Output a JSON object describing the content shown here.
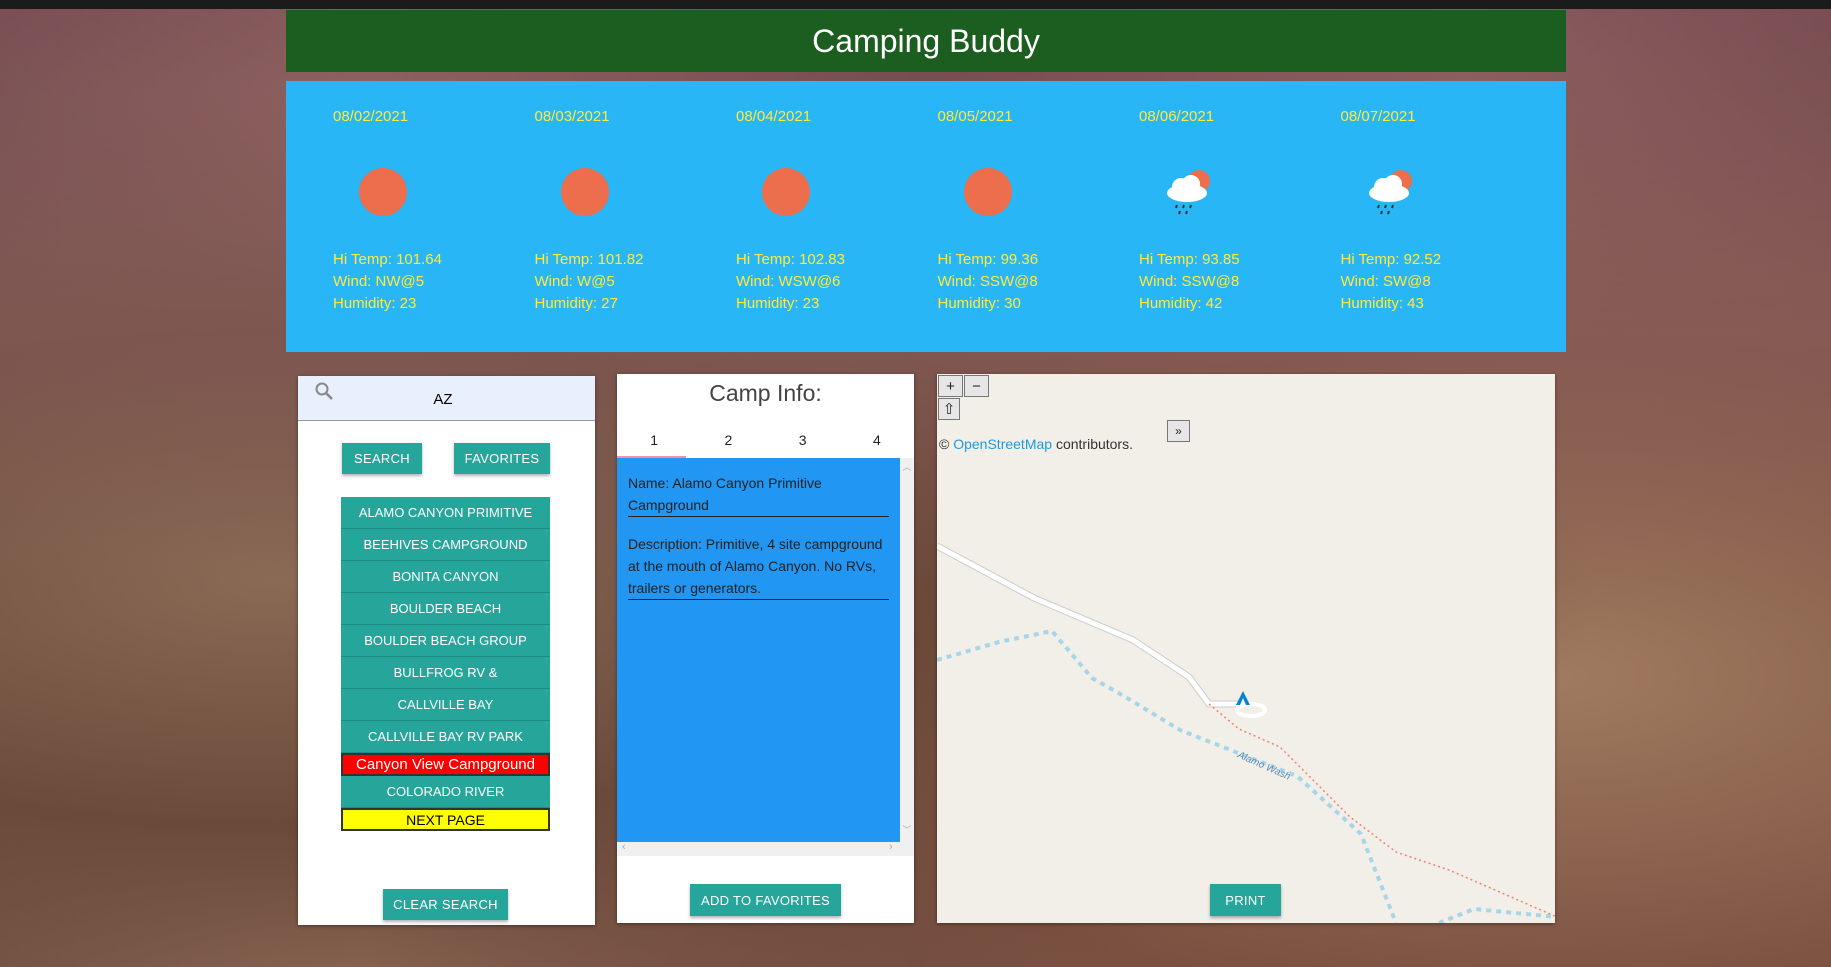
{
  "app": {
    "title": "Camping Buddy"
  },
  "colors": {
    "header": "#1b5e20",
    "weather_bg": "#29b6f6",
    "weather_text": "#ffeb3b",
    "button": "#26a69a",
    "selected": "#ff0000",
    "next_page": "#ffff00",
    "content_bg": "#2196f3",
    "sun": "#ec6e4c"
  },
  "forecast": [
    {
      "date": "08/02/2021",
      "icon": "sun-icon",
      "hi_temp": "Hi Temp: 101.64",
      "wind": "Wind: NW@5",
      "humidity": "Humidity: 23"
    },
    {
      "date": "08/03/2021",
      "icon": "sun-icon",
      "hi_temp": "Hi Temp: 101.82",
      "wind": "Wind: W@5",
      "humidity": "Humidity: 27"
    },
    {
      "date": "08/04/2021",
      "icon": "sun-icon",
      "hi_temp": "Hi Temp: 102.83",
      "wind": "Wind: WSW@6",
      "humidity": "Humidity: 23"
    },
    {
      "date": "08/05/2021",
      "icon": "sun-icon",
      "hi_temp": "Hi Temp: 99.36",
      "wind": "Wind: SSW@8",
      "humidity": "Humidity: 30"
    },
    {
      "date": "08/06/2021",
      "icon": "rain-cloud-sun-icon",
      "hi_temp": "Hi Temp: 93.85",
      "wind": "Wind: SSW@8",
      "humidity": "Humidity: 42"
    },
    {
      "date": "08/07/2021",
      "icon": "rain-cloud-sun-icon",
      "hi_temp": "Hi Temp: 92.52",
      "wind": "Wind: SW@8",
      "humidity": "Humidity: 43"
    }
  ],
  "search": {
    "value": "AZ",
    "search_label": "SEARCH",
    "favorites_label": "FAVORITES",
    "clear_label": "CLEAR SEARCH"
  },
  "campgrounds": [
    "ALAMO CANYON PRIMITIVE",
    "BEEHIVES CAMPGROUND",
    "BONITA CANYON",
    "BOULDER BEACH",
    "BOULDER BEACH GROUP",
    "BULLFROG RV &",
    "CALLVILLE BAY",
    "CALLVILLE BAY RV PARK",
    "Canyon View Campground",
    "COLORADO RIVER"
  ],
  "next_page_label": "NEXT PAGE",
  "camp_info": {
    "title": "Camp Info:",
    "tabs": [
      "1",
      "2",
      "3",
      "4"
    ],
    "name": "Name: Alamo Canyon Primitive Campground",
    "description": "Description: Primitive, 4 site campground at the mouth of Alamo Canyon. No RVs, trailers or generators.",
    "add_label": "ADD TO FAVORITES"
  },
  "map": {
    "zoom_in": "+",
    "zoom_out": "−",
    "home": "⇧",
    "expand": "»",
    "attr_prefix": "©",
    "attr_link": "OpenStreetMap",
    "attr_suffix": "contributors.",
    "wash_label": "Alamo Wash",
    "print_label": "PRINT"
  }
}
